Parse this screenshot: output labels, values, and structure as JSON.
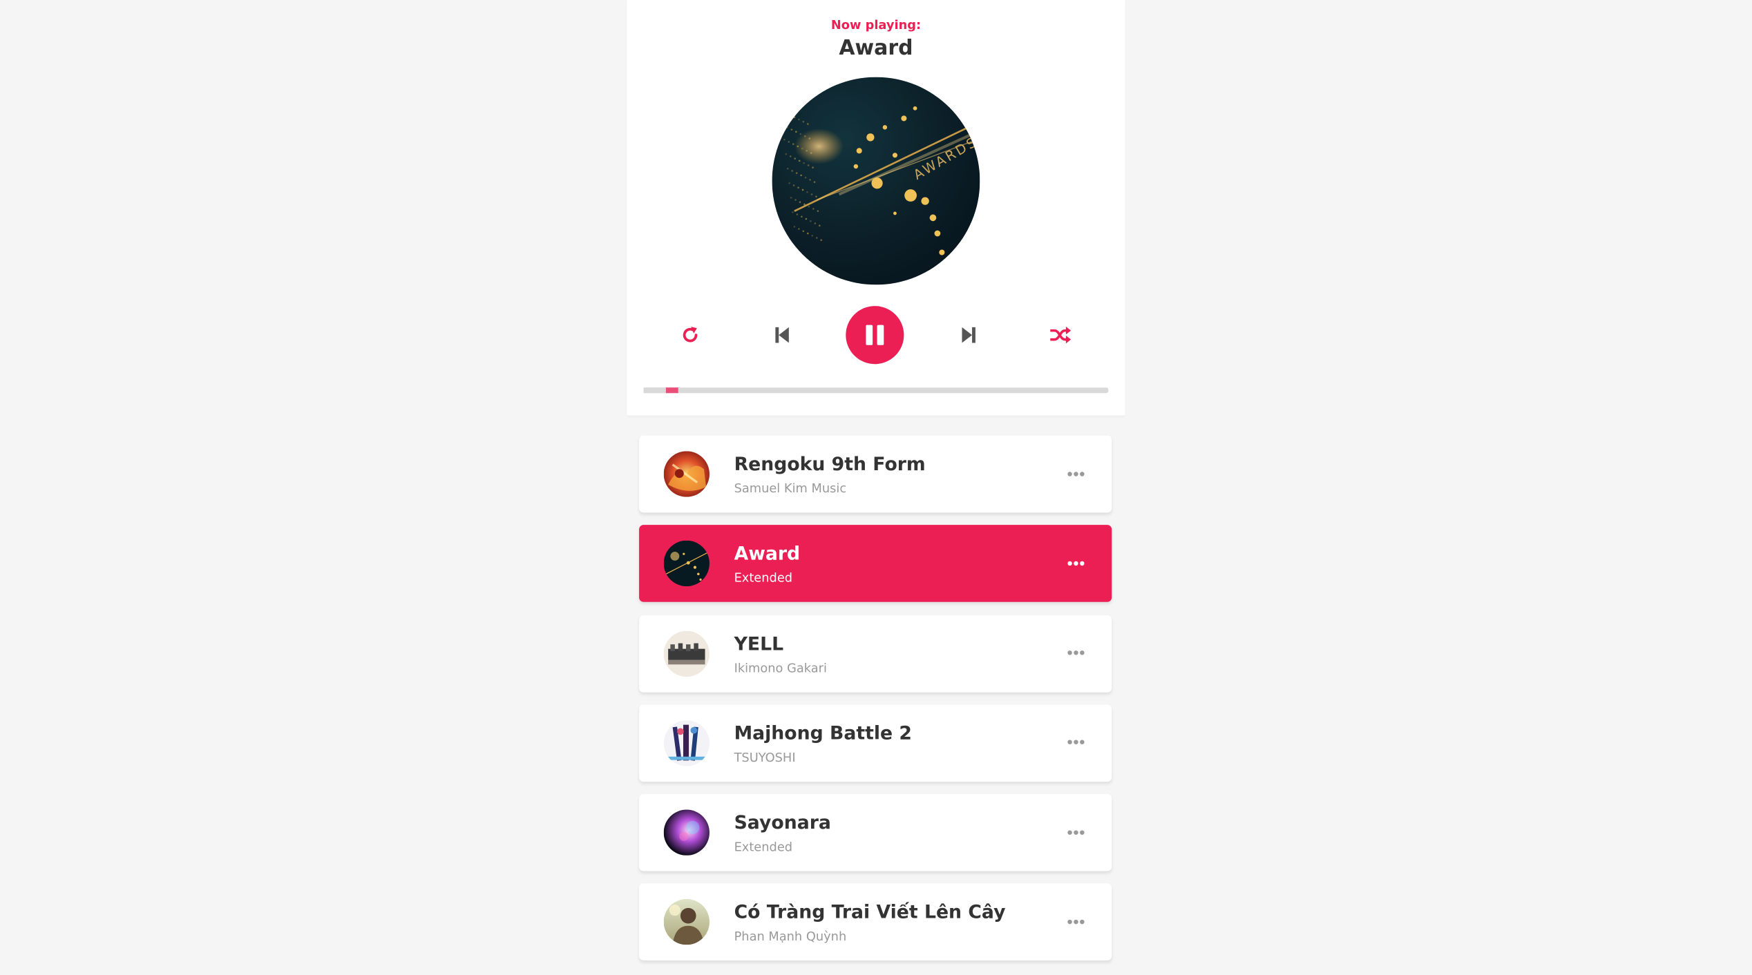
{
  "colors": {
    "accent": "#ec1f55",
    "title_text": "#333333",
    "subtitle_text": "#999999",
    "track": "#d9d9d9",
    "page_bg": "#f5f5f5"
  },
  "dashboard": {
    "now_playing_label": "Now playing:",
    "current_title": "Award",
    "cd_art": "Awards artwork",
    "progress": 0.05,
    "controls": {
      "repeat_icon": "redo-icon",
      "prev_icon": "step-backward-icon",
      "play_state": "playing",
      "play_icon": "pause-icon",
      "next_icon": "step-forward-icon",
      "random_icon": "shuffle-icon"
    }
  },
  "playlist": [
    {
      "title": "Rengoku 9th Form",
      "author": "Samuel Kim Music",
      "active": false,
      "art": "fire"
    },
    {
      "title": "Award",
      "author": "Extended",
      "active": true,
      "art": "award"
    },
    {
      "title": "YELL",
      "author": "Ikimono Gakari",
      "active": false,
      "art": "group"
    },
    {
      "title": "Majhong Battle 2",
      "author": "TSUYOSHI",
      "active": false,
      "art": "anime"
    },
    {
      "title": "Sayonara",
      "author": "Extended",
      "active": false,
      "art": "nebula"
    },
    {
      "title": "Có Tràng Trai Viết Lên Cây",
      "author": "Phan Mạnh Quỳnh",
      "active": false,
      "art": "portrait"
    }
  ]
}
